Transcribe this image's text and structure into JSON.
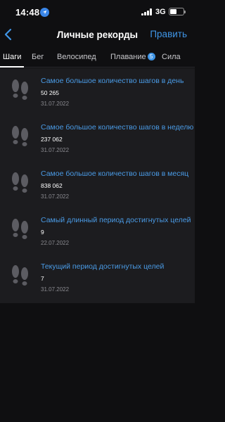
{
  "status_bar": {
    "time": "14:48",
    "network": "3G",
    "icons": [
      "location-arrow-icon",
      "signal-bars-icon",
      "battery-icon"
    ]
  },
  "nav": {
    "title": "Личные рекорды",
    "edit_label": "Править",
    "back_icon": "chevron-left-icon"
  },
  "tabs": [
    {
      "label": "Шаги",
      "active": true
    },
    {
      "label": "Бег",
      "active": false
    },
    {
      "label": "Велосипед",
      "active": false
    },
    {
      "label": "Плавание",
      "badge": "5",
      "active": false
    },
    {
      "label": "Сила",
      "active": false
    }
  ],
  "records": [
    {
      "title": "Самое большое количество шагов в день",
      "value": "50 265",
      "date": "31.07.2022"
    },
    {
      "title": "Самое большое количество шагов в неделю",
      "value": "237 062",
      "date": "31.07.2022"
    },
    {
      "title": "Самое большое количество шагов в месяц",
      "value": "838 062",
      "date": "31.07.2022"
    },
    {
      "title": "Самый длинный период достигнутых целей",
      "value": "9",
      "date": "22.07.2022"
    },
    {
      "title": "Текущий период достигнутых целей",
      "value": "7",
      "date": "31.07.2022"
    }
  ],
  "colors": {
    "accent": "#3f95e6",
    "background": "#0f0f11",
    "card": "#1c1c1f",
    "muted": "#8a8a90",
    "icon": "#5c5c62"
  }
}
